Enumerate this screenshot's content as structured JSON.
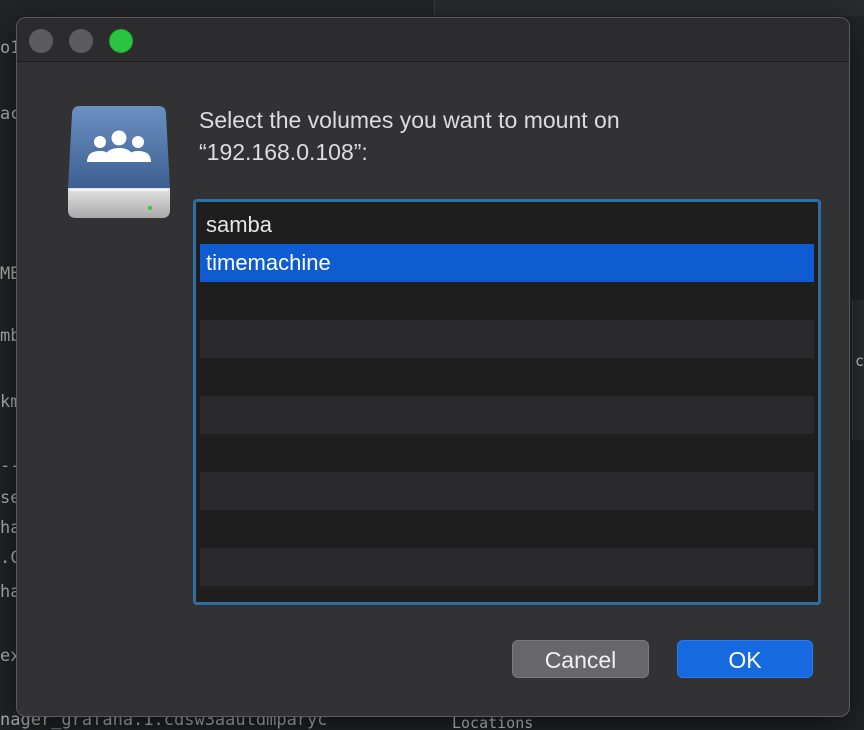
{
  "background": {
    "terminal_fragments": [
      "o1",
      "ac",
      "MB",
      "mb",
      "km",
      "--",
      "se",
      "ha",
      ".C",
      "ha",
      "ex"
    ],
    "bottom_line": "nager_grafana.1.cdsw3aautdmparyc",
    "right_fragment": "c",
    "bottom_right_fragment": "Locations"
  },
  "dialog": {
    "icon": "network-drive-group-icon",
    "prompt_line1": "Select the volumes you want to mount on",
    "prompt_line2": "“192.168.0.108”:",
    "volumes": [
      "samba",
      "timemachine"
    ],
    "selected_volume": "timemachine",
    "cancel_label": "Cancel",
    "ok_label": "OK",
    "colors": {
      "selection": "#0f5bd1",
      "list_focus_ring": "#2f6da3",
      "ok_button": "#1769e0",
      "zoom_button": "#2ac43f"
    }
  }
}
